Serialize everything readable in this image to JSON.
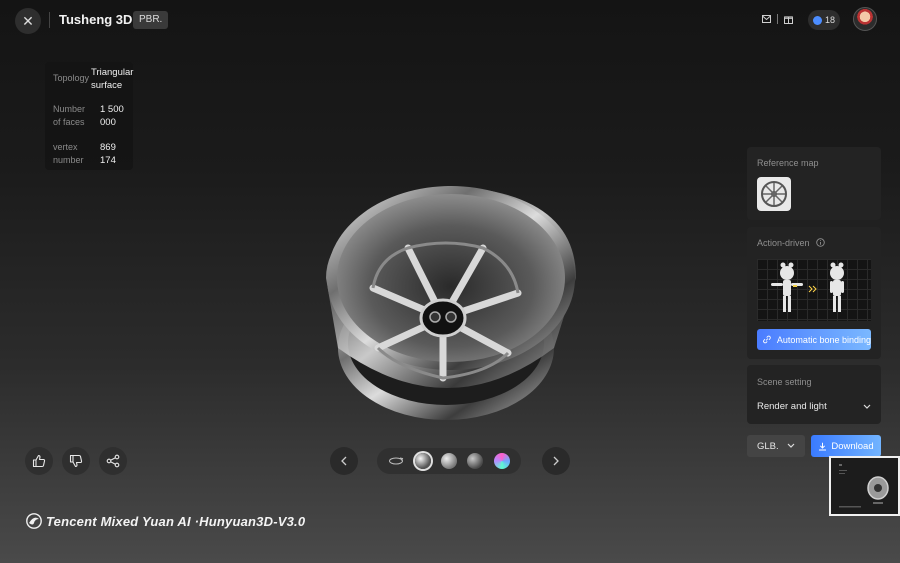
{
  "header": {
    "title": "Tusheng 3D",
    "badge": "PBR.",
    "points": "18"
  },
  "stats": {
    "topology_label": "Topology",
    "topology_value_1": "Triangular",
    "topology_value_2": "surface",
    "faces_label_1": "Number",
    "faces_label_2": "of faces",
    "faces_value_1": "1 500",
    "faces_value_2": "000",
    "vertex_label_1": "vertex",
    "vertex_label_2": "number",
    "vertex_value_1": "869",
    "vertex_value_2": "174"
  },
  "panel": {
    "reference_map_title": "Reference map",
    "action_driven_title": "Action-driven",
    "bone_binding_label": "Automatic bone binding",
    "scene_setting_title": "Scene setting",
    "scene_option": "Render and light"
  },
  "export": {
    "format": "GLB.",
    "download_label": "Download"
  },
  "brand": {
    "text": "Tencent Mixed Yuan AI ·Hunyuan3D-V3.0"
  },
  "icons": {
    "close": "close-icon",
    "mail": "mail-icon",
    "gift": "gift-icon",
    "like": "thumbs-up-icon",
    "dislike": "thumbs-down-icon",
    "share": "share-icon",
    "prev": "chevron-left-icon",
    "next": "chevron-right-icon",
    "rotate": "rotate-icon"
  },
  "colors": {
    "accent": "#4a7cff",
    "accent_light": "#7ab8ff"
  }
}
